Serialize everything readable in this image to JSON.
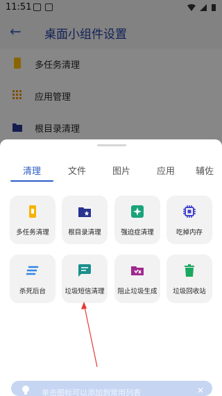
{
  "status": {
    "time": "11:51"
  },
  "app_bar": {
    "title": "桌面小组件设置"
  },
  "background_list": [
    "多任务清理",
    "应用管理",
    "根目录清理"
  ],
  "tabs": [
    "清理",
    "文件",
    "图片",
    "应用",
    "辅佐"
  ],
  "active_tab": "清理",
  "tiles": [
    {
      "label": "多任务清理",
      "icon": "phone-icon",
      "color": "#f5b400"
    },
    {
      "label": "根目录清理",
      "icon": "folder-star-icon",
      "color": "#27338f"
    },
    {
      "label": "强迫症清理",
      "icon": "sparkle-icon",
      "color": "#1aa37a"
    },
    {
      "label": "吃掉内存",
      "icon": "chip-icon",
      "color": "#3f3fd0"
    },
    {
      "label": "杀死后台",
      "icon": "lines-icon",
      "color": "#2f86e6"
    },
    {
      "label": "垃圾短信清理",
      "icon": "message-icon",
      "color": "#1a8f8c"
    },
    {
      "label": "阻止垃圾生成",
      "icon": "folder-x-icon",
      "color": "#a0288f"
    },
    {
      "label": "垃圾回收站",
      "icon": "trash-icon",
      "color": "#19a85f"
    }
  ],
  "bottom_hint": {
    "text": "单击图标可以添加到常用列表"
  }
}
